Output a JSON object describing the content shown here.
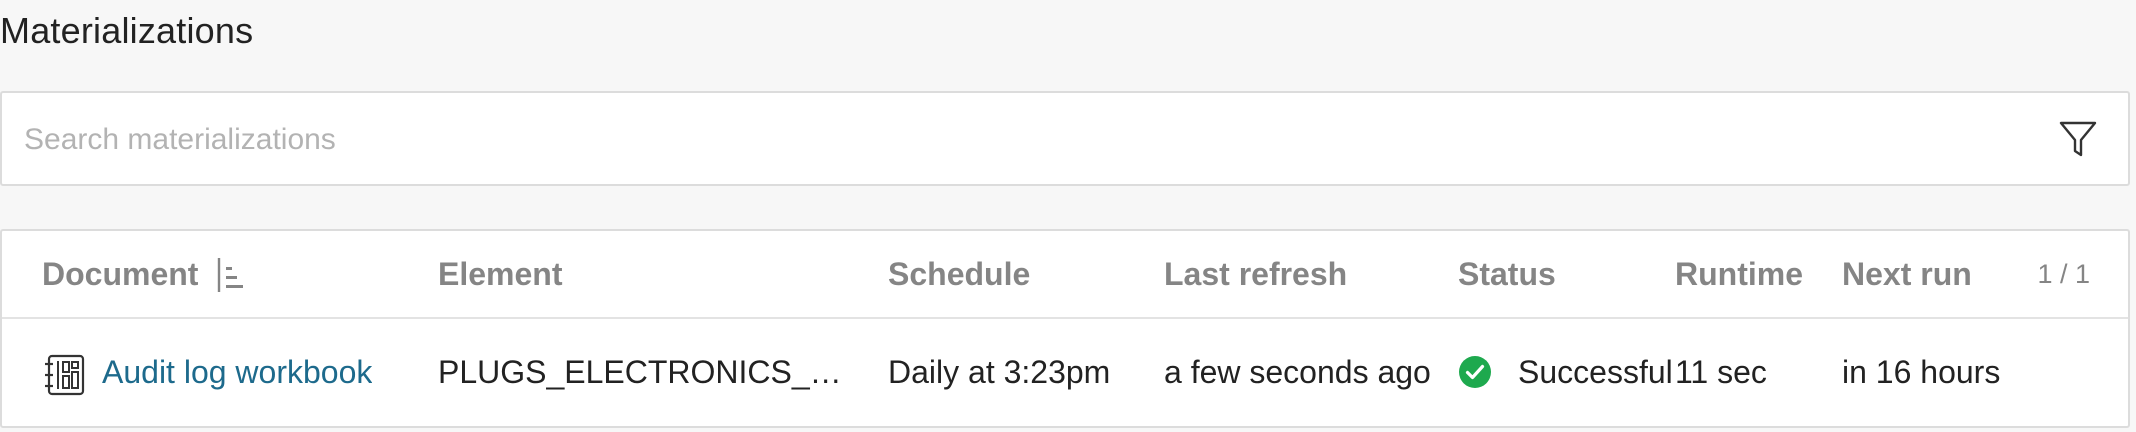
{
  "page": {
    "title": "Materializations"
  },
  "search": {
    "placeholder": "Search materializations",
    "value": "",
    "filter_icon": "filter-icon"
  },
  "table": {
    "columns": {
      "document": "Document",
      "element": "Element",
      "schedule": "Schedule",
      "last_refresh": "Last refresh",
      "status": "Status",
      "runtime": "Runtime",
      "next_run": "Next run"
    },
    "sort_icon": "sort-icon",
    "pagination": "1 / 1",
    "rows": [
      {
        "document_icon": "workbook-icon",
        "document": "Audit log workbook",
        "element": "PLUGS_ELECTRONICS_HA…",
        "schedule": "Daily at 3:23pm",
        "last_refresh": "a few seconds ago",
        "status_icon": "check-circle-icon",
        "status": "Successful",
        "runtime": "11 sec",
        "next_run": "in 16 hours"
      }
    ]
  },
  "colors": {
    "link": "#1d6a8c",
    "success": "#1ea94e",
    "header_text": "#858585",
    "border": "#dcdcdc",
    "background": "#f7f7f7"
  }
}
